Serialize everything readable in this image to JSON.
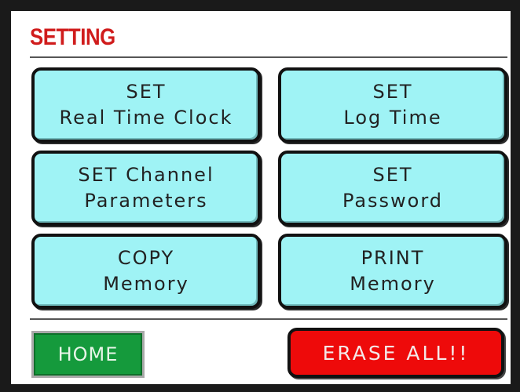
{
  "screen": {
    "title": "SETTING"
  },
  "menu": {
    "buttons": [
      {
        "line1": "SET",
        "line2": "Real Time Clock"
      },
      {
        "line1": "SET",
        "line2": "Log Time"
      },
      {
        "line1": "SET Channel",
        "line2": "Parameters"
      },
      {
        "line1": "SET",
        "line2": "Password"
      },
      {
        "line1": "COPY",
        "line2": "Memory"
      },
      {
        "line1": "PRINT",
        "line2": "Memory"
      }
    ]
  },
  "footer": {
    "home_label": "HOME",
    "erase_label": "ERASE ALL!!"
  },
  "colors": {
    "title": "#d01c1c",
    "menu_button": "#9ff3f5",
    "home_button": "#159a3c",
    "erase_button": "#ee0a0a"
  }
}
